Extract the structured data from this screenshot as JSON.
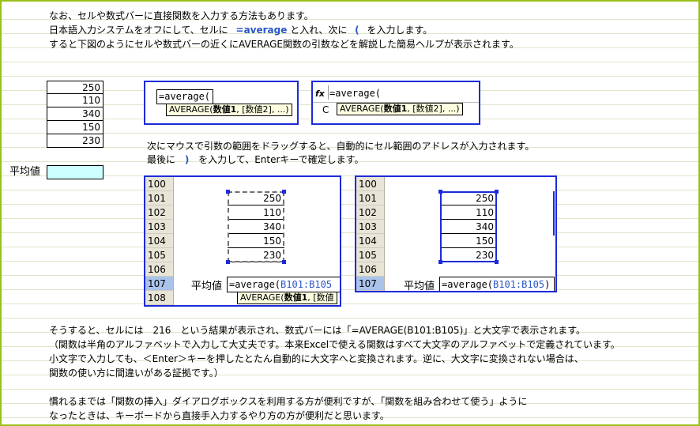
{
  "intro": {
    "line1": "なお、セルや数式バーに直接関数を入力する方法もあります。",
    "line2_a": "日本語入力システムをオフにして、セルに",
    "line2_code": "=average",
    "line2_b": "と入れ、次に",
    "line2_paren": "(",
    "line2_c": "を入力します。",
    "line3": "すると下図のようにセルや数式バーの近くにAVERAGE関数の引数などを解説した簡易ヘルプが表示されます。"
  },
  "cells": {
    "values": [
      "250",
      "110",
      "340",
      "150",
      "230"
    ],
    "avg_label": "平均値"
  },
  "example1": {
    "formula": "=average(",
    "tip_prefix": "AVERAGE(",
    "tip_bold": "数値1",
    "tip_suffix": ", [数値2], ...)"
  },
  "example2": {
    "fx_label": "fx",
    "formula": "=average(",
    "cell_letter": "C",
    "tip_prefix": "AVERAGE(",
    "tip_bold": "数値1",
    "tip_suffix": ", [数値2], ...)"
  },
  "middle": {
    "line1": "次にマウスで引数の範囲をドラッグすると、自動的にセル範囲のアドレスが入力されます。",
    "line2_a": "最後に",
    "line2_paren": ")",
    "line2_b": "を入力して、Enterキーで確定します。"
  },
  "example3": {
    "row_numbers": [
      "100",
      "101",
      "102",
      "103",
      "104",
      "105",
      "106",
      "107",
      "108"
    ],
    "values": [
      "250",
      "110",
      "340",
      "150",
      "230"
    ],
    "avg_label": "平均値",
    "formula_prefix": "=average(",
    "formula_ref": "B101:B105",
    "tip_prefix": "AVERAGE(",
    "tip_bold": "数値1",
    "tip_suffix": ", [数値"
  },
  "example4": {
    "row_numbers": [
      "100",
      "101",
      "102",
      "103",
      "104",
      "105",
      "106",
      "107"
    ],
    "values": [
      "250",
      "110",
      "340",
      "150",
      "230"
    ],
    "avg_label": "平均値",
    "formula_prefix": "=average(",
    "formula_ref": "B101:B105",
    "formula_suffix": ")"
  },
  "bottom": {
    "line1": "そうすると、セルには　216　という結果が表示され、数式バーには「=AVERAGE(B101:B105)」と大文字で表示されます。",
    "line2": "（関数は半角のアルファベットで入力して大丈夫です。本来Excelで使える関数はすべて大文字のアルファベットで定義されています。",
    "line3": "小文字で入力しても、＜Enter＞キーを押したとたん自動的に大文字へと変換されます。逆に、大文字に変換されない場合は、",
    "line4": "関数の使い方に間違いがある証拠です。）",
    "line5": "慣れるまでは「関数の挿入」ダイアログボックスを利用する方が便利ですが、「関数を組み合わせて使う」ように",
    "line6": "なったときは、キーボードから直接手入力するやり方の方が便利だと思います。"
  }
}
